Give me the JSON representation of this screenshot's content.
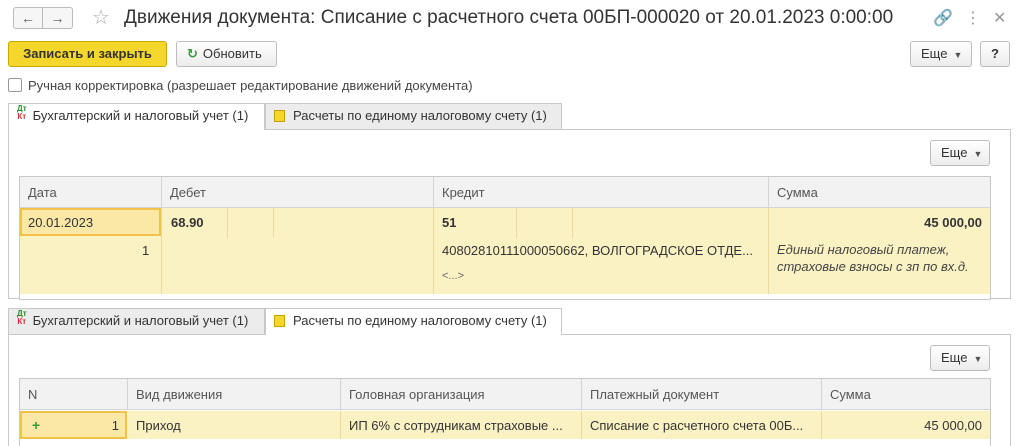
{
  "window": {
    "title": "Движения документа: Списание с расчетного счета 00БП-000020 от 20.01.2023 0:00:00"
  },
  "toolbar": {
    "save_close_label": "Записать и закрыть",
    "refresh_label": "Обновить",
    "more_label": "Еще",
    "help_label": "?"
  },
  "manual_edit": {
    "label": "Ручная корректировка (разрешает редактирование движений документа)",
    "checked": false
  },
  "tabs": [
    {
      "label": "Бухгалтерский и налоговый учет (1)"
    },
    {
      "label": "Расчеты по единому налоговому счету (1)"
    }
  ],
  "accounting": {
    "more_label": "Еще",
    "columns": [
      "Дата",
      "Дебет",
      "Кредит",
      "Сумма"
    ],
    "row": {
      "date": "20.01.2023",
      "line_no": "1",
      "debit_account": "68.90",
      "credit_account": "51",
      "credit_subconto": "40802810111000050662, ВОЛГОГРАДСКОЕ ОТДЕ...",
      "credit_placeholder": "<...>",
      "amount": "45 000,00",
      "description_line1": "Единый налоговый платеж,",
      "description_line2": "страховые  взносы с зп по вх.д."
    }
  },
  "ens": {
    "more_label": "Еще",
    "columns": [
      "N",
      "Вид движения",
      "Головная организация",
      "Платежный документ",
      "Сумма"
    ],
    "row": {
      "n": "1",
      "movement": "Приход",
      "organization": "ИП 6% с сотрудникам страховые ...",
      "payment_doc": "Списание с расчетного счета 00Б...",
      "amount": "45 000,00"
    }
  }
}
